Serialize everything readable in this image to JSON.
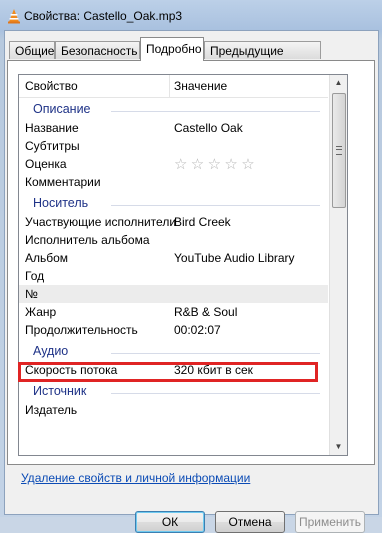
{
  "window": {
    "title": "Свойства: Castello_Oak.mp3",
    "icon": "vlc-cone-icon"
  },
  "tabs": [
    {
      "label": "Общие",
      "active": false
    },
    {
      "label": "Безопасность",
      "active": false
    },
    {
      "label": "Подробно",
      "active": true
    },
    {
      "label": "Предыдущие версии",
      "active": false
    }
  ],
  "table": {
    "headers": {
      "property": "Свойство",
      "value": "Значение"
    },
    "groups": {
      "description": "Описание",
      "media": "Носитель",
      "audio": "Аудио",
      "source": "Источник"
    },
    "rows": {
      "title": {
        "k": "Название",
        "v": "Castello Oak"
      },
      "subtitles": {
        "k": "Субтитры",
        "v": ""
      },
      "rating": {
        "k": "Оценка",
        "stars": 0,
        "max_stars": 5,
        "star_glyph": "☆"
      },
      "comments": {
        "k": "Комментарии",
        "v": ""
      },
      "artists": {
        "k": "Участвующие исполнители",
        "v": "Bird Creek"
      },
      "album_artist": {
        "k": "Исполнитель альбома",
        "v": ""
      },
      "album": {
        "k": "Альбом",
        "v": "YouTube Audio Library"
      },
      "year": {
        "k": "Год",
        "v": ""
      },
      "number": {
        "k": "№",
        "v": ""
      },
      "genre": {
        "k": "Жанр",
        "v": "R&B & Soul"
      },
      "length": {
        "k": "Продолжительность",
        "v": "00:02:07"
      },
      "bitrate": {
        "k": "Скорость потока",
        "v": "320 кбит в сек"
      },
      "publisher": {
        "k": "Издатель",
        "v": ""
      }
    }
  },
  "link": "Удаление свойств и личной информации",
  "buttons": {
    "ok": "ОК",
    "cancel": "Отмена",
    "apply": "Применить"
  },
  "colors": {
    "highlight": "#e02424",
    "group_label": "#1e3287",
    "link": "#0b4bb5"
  }
}
